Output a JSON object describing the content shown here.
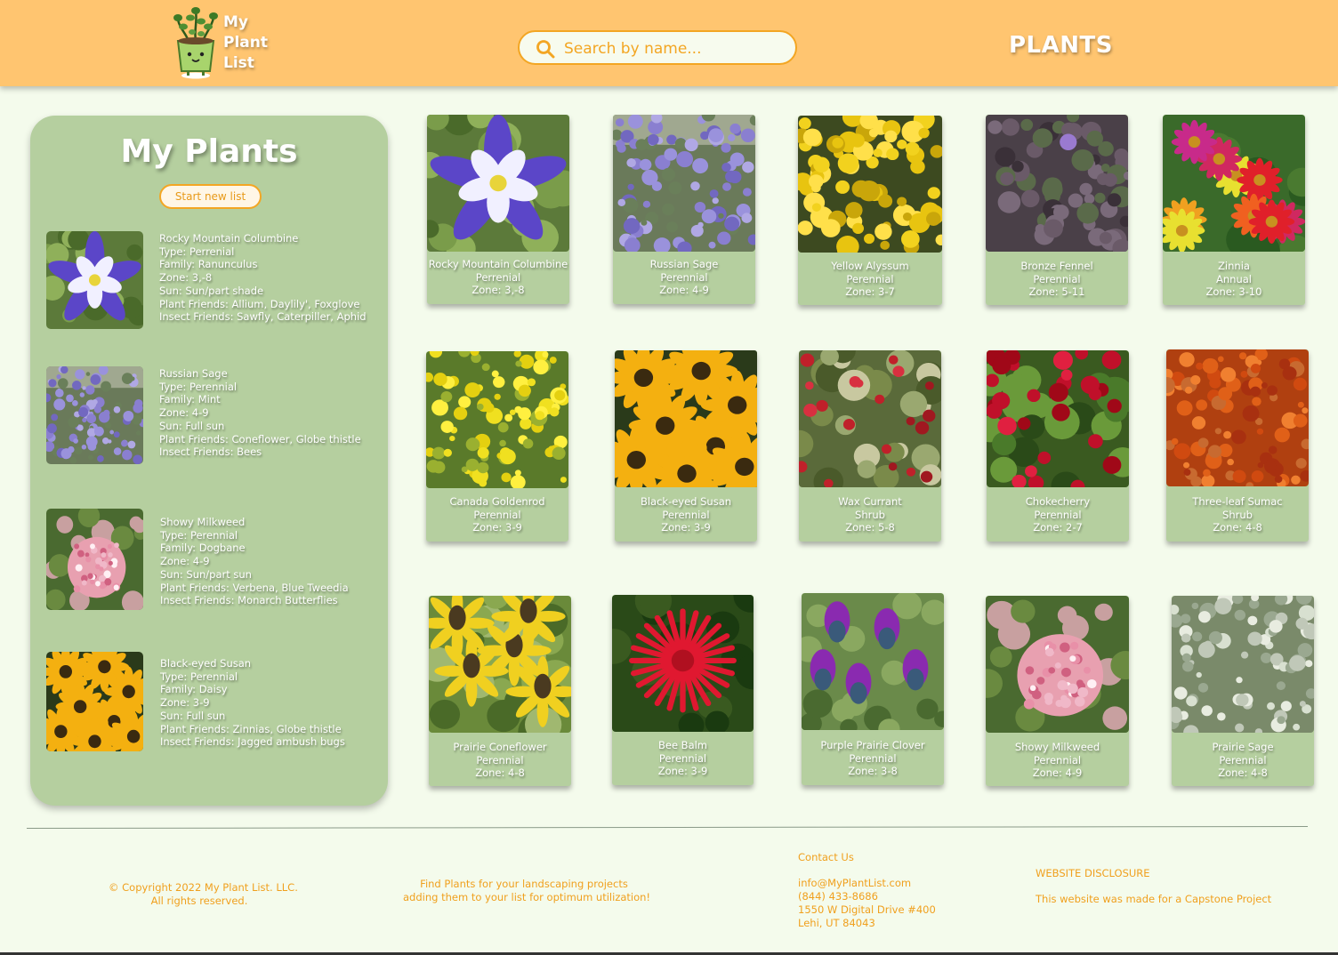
{
  "header": {
    "logo_lines": [
      "My",
      "Plant",
      "List"
    ],
    "search_placeholder": "Search by name...",
    "nav_plants": "PLANTS"
  },
  "sidebar": {
    "title": "My Plants",
    "start_button": "Start new list",
    "items": [
      {
        "lines": [
          "Rocky Mountain Columbine",
          "Type: Perrenial",
          "Family: Ranunculus",
          "Zone: 3,-8",
          "Sun: Sun/part shade",
          "Plant Friends: Allium, Daylily', Foxglove",
          "Insect Friends: Sawfly, Caterpiller, Aphid"
        ],
        "photo": "columbine"
      },
      {
        "lines": [
          "Russian Sage",
          "Type: Perennial",
          "Family: Mint",
          "Zone: 4-9",
          "Sun: Full sun",
          "Plant Friends: Coneflower, Globe thistle",
          "Insect Friends: Bees"
        ],
        "photo": "sage"
      },
      {
        "lines": [
          "Showy Milkweed",
          "Type: Perennial",
          "Family: Dogbane",
          "Zone: 4-9",
          "Sun: Sun/part sun",
          "Plant Friends: Verbena, Blue Tweedia",
          "Insect Friends: Monarch Butterflies"
        ],
        "photo": "milkweed"
      },
      {
        "lines": [
          "Black-eyed Susan",
          "Type: Perennial",
          "Family: Daisy",
          "Zone: 3-9",
          "Sun: Full sun",
          "Plant Friends: Zinnias, Globe thistle",
          "Insect Friends: Jagged ambush bugs"
        ],
        "photo": "susan"
      }
    ]
  },
  "plants": [
    {
      "name": "Rocky Mountain Columbine",
      "type": "Perrenial",
      "zone": "Zone: 3,-8",
      "photo": "columbine"
    },
    {
      "name": "Russian Sage",
      "type": "Perennial",
      "zone": "Zone: 4-9",
      "photo": "sage"
    },
    {
      "name": "Yellow Alyssum",
      "type": "Perennial",
      "zone": "Zone: 3-7",
      "photo": "alyssum"
    },
    {
      "name": "Bronze Fennel",
      "type": "Perennial",
      "zone": "Zone: 5-11",
      "photo": "fennel"
    },
    {
      "name": "Zinnia",
      "type": "Annual",
      "zone": "Zone: 3-10",
      "photo": "zinnia"
    },
    {
      "name": "Canada Goldenrod",
      "type": "Perennial",
      "zone": "Zone: 3-9",
      "photo": "goldenrod"
    },
    {
      "name": "Black-eyed Susan",
      "type": "Perennial",
      "zone": "Zone: 3-9",
      "photo": "susan"
    },
    {
      "name": "Wax Currant",
      "type": "Shrub",
      "zone": "Zone: 5-8",
      "photo": "currant"
    },
    {
      "name": "Chokecherry",
      "type": "Perennial",
      "zone": "Zone: 2-7",
      "photo": "cherry"
    },
    {
      "name": "Three-leaf Sumac",
      "type": "Shrub",
      "zone": "Zone: 4-8",
      "photo": "sumac"
    },
    {
      "name": "Prairie Coneflower",
      "type": "Perennial",
      "zone": "Zone: 4-8",
      "photo": "coneflower"
    },
    {
      "name": "Bee Balm",
      "type": "Perennial",
      "zone": "Zone: 3-9",
      "photo": "beebalm"
    },
    {
      "name": "Purple Prairie Clover",
      "type": "Perennial",
      "zone": "Zone: 3-8",
      "photo": "clover"
    },
    {
      "name": "Showy Milkweed",
      "type": "Perennial",
      "zone": "Zone: 4-9",
      "photo": "milkweed"
    },
    {
      "name": "Prairie Sage",
      "type": "Perennial",
      "zone": "Zone: 4-8",
      "photo": "prairiesage"
    }
  ],
  "footer": {
    "copyright": [
      "© Copyright 2022 My Plant List. LLC.",
      "All rights reserved."
    ],
    "tagline": [
      "Find Plants for your landscaping projects",
      "adding them to your list for optimum utilization!"
    ],
    "contact_title": "Contact Us",
    "contact_lines": [
      "info@MyPlantList.com",
      "(844) 433-8686",
      "1550 W Digital Drive #400",
      "Lehi, UT 84043"
    ],
    "disclosure_title": "WEBSITE DISCLOSURE",
    "disclosure_text": "This website was made for a Capstone Project"
  },
  "colors": {
    "header": "#ffc570",
    "accent": "#f3a623",
    "panel": "#b5cf9f",
    "background": "#f4fbec"
  }
}
